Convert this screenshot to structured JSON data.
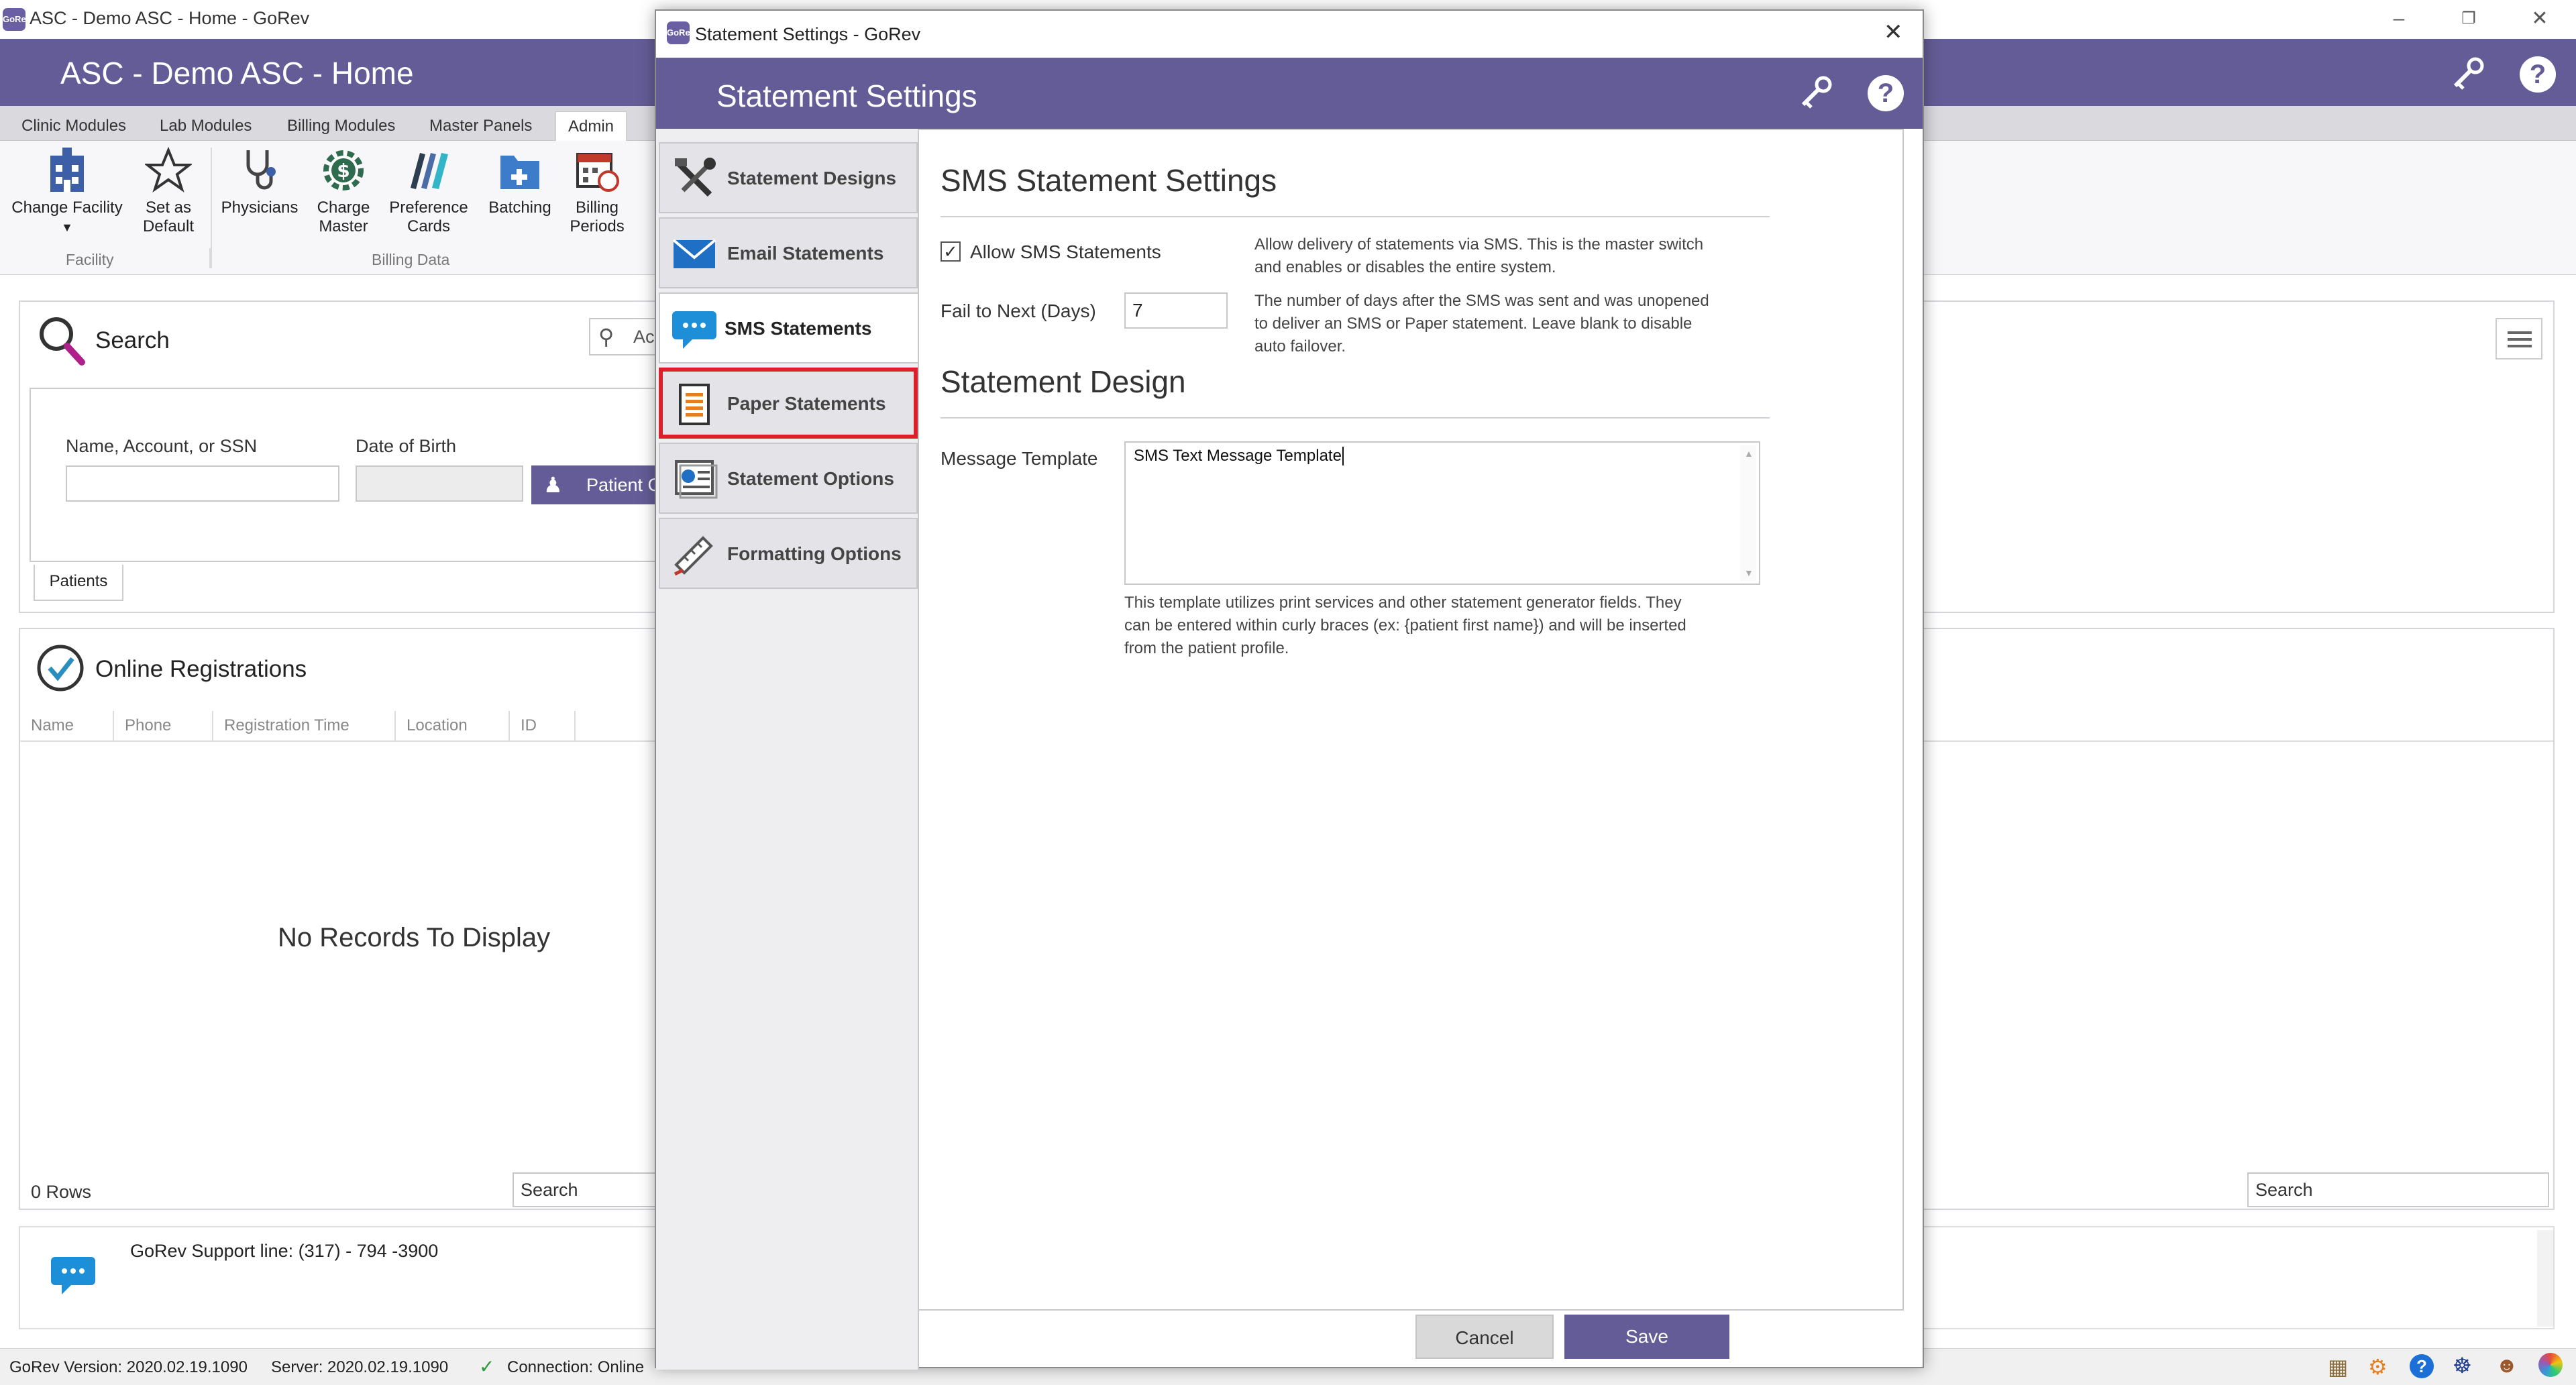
{
  "window": {
    "title": "ASC - Demo ASC - Home - GoRev",
    "app_badge": "GoRev",
    "header_title": "ASC - Demo ASC - Home"
  },
  "ribbon": {
    "tabs": [
      "Clinic Modules",
      "Lab Modules",
      "Billing Modules",
      "Master Panels",
      "Admin"
    ],
    "active_tab": "Admin",
    "buttons": {
      "change_facility": "Change Facility",
      "set_default_1": "Set as",
      "set_default_2": "Default",
      "physicians": "Physicians",
      "charge_master_1": "Charge",
      "charge_master_2": "Master",
      "preference_cards_1": "Preference",
      "preference_cards_2": "Cards",
      "batching": "Batching",
      "billing_periods_1": "Billing",
      "billing_periods_2": "Periods"
    },
    "groups": {
      "facility": "Facility",
      "billing_data": "Billing Data"
    }
  },
  "search_panel": {
    "title": "Search",
    "right_input_fragment": "Ac",
    "name_label": "Name, Account, or SSN",
    "dob_label": "Date of Birth",
    "patient_button": "Patient C",
    "tab": "Patients"
  },
  "registrations": {
    "title": "Online Registrations",
    "columns": [
      "Name",
      "Phone",
      "Registration Time",
      "Location",
      "ID"
    ],
    "empty": "No Records To Display",
    "rows": "0 Rows",
    "search_placeholder": "Search",
    "right_search_placeholder": "Search"
  },
  "support": {
    "text": "GoRev Support line: (317) - 794 -3900"
  },
  "statusbar": {
    "version": "GoRev Version: 2020.02.19.1090",
    "server": "Server: 2020.02.19.1090",
    "connection": "Connection: Online"
  },
  "dialog": {
    "title": "Statement Settings - GoRev",
    "header_title": "Statement Settings",
    "nav": [
      {
        "label": "Statement Designs",
        "icon": "tools-icon"
      },
      {
        "label": "Email Statements",
        "icon": "envelope-icon"
      },
      {
        "label": "SMS Statements",
        "icon": "chat-bubble-icon"
      },
      {
        "label": "Paper Statements",
        "icon": "paper-document-icon"
      },
      {
        "label": "Statement Options",
        "icon": "statement-options-icon"
      },
      {
        "label": "Formatting Options",
        "icon": "ruler-pencil-icon"
      }
    ],
    "selected_nav": "SMS Statements",
    "highlighted_nav": "Paper Statements",
    "sms_settings": {
      "heading": "SMS Statement Settings",
      "allow_label": "Allow SMS Statements",
      "allow_checked": true,
      "allow_help_1": "Allow delivery of statements via SMS. This is the master switch",
      "allow_help_2": "and enables or disables the entire system.",
      "fail_label": "Fail to Next (Days)",
      "fail_value": "7",
      "fail_help_1": "The number of days after the SMS was sent and was unopened",
      "fail_help_2": "to deliver an SMS or Paper statement. Leave blank to disable",
      "fail_help_3": "auto failover."
    },
    "design": {
      "heading": "Statement Design",
      "template_label": "Message Template",
      "template_value": "SMS Text Message Template",
      "template_help_1": "This template utilizes print services and other statement generator fields. They",
      "template_help_2": "can be entered within curly braces (ex: {patient first name}) and will be inserted",
      "template_help_3": "from the patient profile."
    },
    "buttons": {
      "cancel": "Cancel",
      "save": "Save"
    }
  },
  "colors": {
    "header": "#645c96",
    "highlight": "#d9202b",
    "save_button": "#645c96",
    "cancel_button": "#d9d9d9"
  }
}
